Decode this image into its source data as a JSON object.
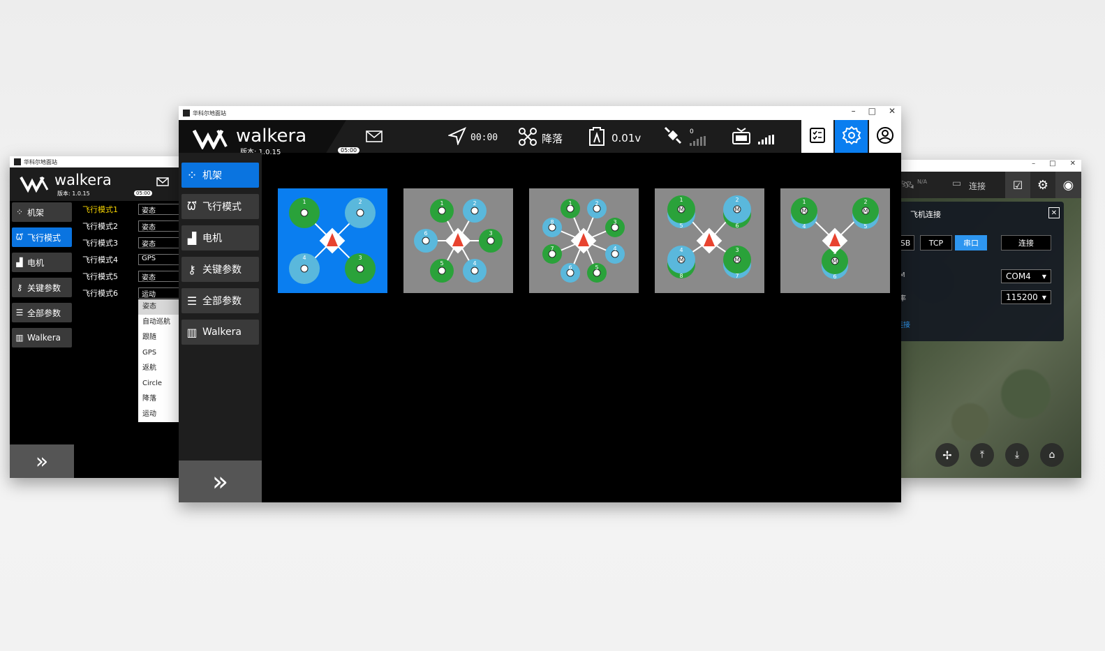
{
  "station_title": "华科尔地面站",
  "brand": "walkera",
  "version_label": "版本: 1.0.15",
  "timer_badge": "05:00",
  "window_controls": {
    "minimize": "–",
    "maximize": "□",
    "close": "✕"
  },
  "status": {
    "flight_time": "00:00",
    "mode": "降落",
    "voltage": "0.01v",
    "satellites": "0"
  },
  "sidebar": {
    "items": [
      {
        "label": "机架",
        "icon": "frame-dots-icon"
      },
      {
        "label": "飞行模式",
        "icon": "wave-icon"
      },
      {
        "label": "电机",
        "icon": "motor-icon"
      },
      {
        "label": "关键参数",
        "icon": "key-icon"
      },
      {
        "label": "全部参数",
        "icon": "sliders-icon"
      },
      {
        "label": "Walkera",
        "icon": "barcode-icon"
      }
    ],
    "expand_icon": "chevron-double-right-icon"
  },
  "left_window": {
    "flight_modes": [
      {
        "label": "飞行模式1",
        "value": "姿态"
      },
      {
        "label": "飞行模式2",
        "value": "姿态"
      },
      {
        "label": "飞行模式3",
        "value": "姿态"
      },
      {
        "label": "飞行模式4",
        "value": "GPS"
      },
      {
        "label": "飞行模式5",
        "value": "姿态"
      },
      {
        "label": "飞行模式6",
        "value": "运动"
      }
    ],
    "dropdown_options": [
      "姿态",
      "自动巡航",
      "跟随",
      "GPS",
      "返航",
      "Circle",
      "降落",
      "运动"
    ]
  },
  "frames": [
    {
      "type": "quad-x",
      "numbers": [
        "1",
        "2",
        "3",
        "4"
      ]
    },
    {
      "type": "hexa",
      "numbers": [
        "1",
        "2",
        "3",
        "4",
        "5",
        "6"
      ]
    },
    {
      "type": "octa",
      "numbers": [
        "1",
        "2",
        "3",
        "4",
        "5",
        "6",
        "7",
        "8"
      ]
    },
    {
      "type": "octa-quad-coax",
      "numbers": [
        "1",
        "2",
        "3",
        "4",
        "5",
        "6",
        "7",
        "8"
      ],
      "motor_label": "M"
    },
    {
      "type": "y6",
      "numbers": [
        "1",
        "2",
        "3",
        "4",
        "5",
        "6"
      ],
      "motor_label": "M"
    }
  ],
  "right_window": {
    "na_label": "N/A",
    "connect_label": "连接",
    "dialog_title": "飞机连接",
    "tabs": [
      "SB",
      "TCP",
      "串口"
    ],
    "connect_button": "连接",
    "port_label": "M",
    "port_value": "COM4",
    "baud_label": "率",
    "baud_value": "115200",
    "link_text": "连接"
  },
  "colors": {
    "accent": "#0a7ef0",
    "rotor_green": "#2aa23a",
    "rotor_blue": "#5ab8dc",
    "alert_red": "#e8432f"
  }
}
